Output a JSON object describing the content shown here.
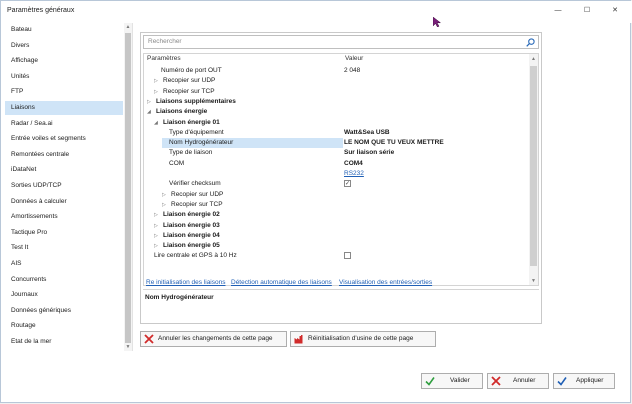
{
  "window": {
    "title": "Paramètres généraux",
    "minimize": "—",
    "maximize": "☐",
    "close": "✕"
  },
  "sidebar": {
    "items": [
      {
        "label": "Bateau"
      },
      {
        "label": "Divers"
      },
      {
        "label": "Affichage"
      },
      {
        "label": "Unités"
      },
      {
        "label": "FTP"
      },
      {
        "label": "Liaisons",
        "selected": true
      },
      {
        "label": "Radar / Sea.ai"
      },
      {
        "label": "Entrée voiles et segments"
      },
      {
        "label": "Remontées centrale"
      },
      {
        "label": "iDataNet"
      },
      {
        "label": "Sorties UDP/TCP"
      },
      {
        "label": "Données à calculer"
      },
      {
        "label": "Amortissements"
      },
      {
        "label": "Tactique Pro"
      },
      {
        "label": "Test It"
      },
      {
        "label": "AIS"
      },
      {
        "label": "Concurrents"
      },
      {
        "label": "Journaux"
      },
      {
        "label": "Données génériques"
      },
      {
        "label": "Routage"
      },
      {
        "label": "Etat de la mer"
      }
    ]
  },
  "search": {
    "placeholder": "Rechercher"
  },
  "grid": {
    "col_param": "Paramètres",
    "col_value": "Valeur",
    "rows": [
      {
        "label": "Numéro de port OUT",
        "value": "2 048",
        "indent": 1
      },
      {
        "label": "Recopier sur UDP",
        "indent": 1,
        "arrow": "▷"
      },
      {
        "label": "Recopier sur TCP",
        "indent": 1,
        "arrow": "▷"
      },
      {
        "label": "Liaisons supplémentaires",
        "indent": 0,
        "arrow": "▷",
        "bold": true
      },
      {
        "label": "Liaisons énergie",
        "indent": 0,
        "arrow": "◢",
        "bold": true
      },
      {
        "label": "Liaison énergie 01",
        "indent": 1,
        "arrow": "◢",
        "bold": true
      },
      {
        "label": "Type d'équipement",
        "value": "Watt&Sea USB",
        "indent": 2,
        "valbold": true
      },
      {
        "label": "Nom Hydrogénérateur",
        "value": "LE NOM QUE TU VEUX METTRE",
        "indent": 2,
        "valbold": true,
        "highlight": true
      },
      {
        "label": "Type de liaison",
        "value": "Sur liaison série",
        "indent": 2,
        "valbold": true
      },
      {
        "label": "COM",
        "value": "COM4",
        "indent": 2,
        "valbold": true
      },
      {
        "label": "",
        "value": "RS232",
        "indent": 2,
        "link": true
      },
      {
        "label": "Vérifier checksum",
        "indent": 2,
        "checkbox": true,
        "checked": true
      },
      {
        "label": "Recopier sur UDP",
        "indent": 2,
        "arrow": "▷"
      },
      {
        "label": "Recopier sur TCP",
        "indent": 2,
        "arrow": "▷"
      },
      {
        "label": "Liaison énergie 02",
        "indent": 1,
        "arrow": "▷",
        "bold": true
      },
      {
        "label": "Liaison énergie 03",
        "indent": 1,
        "arrow": "▷",
        "bold": true
      },
      {
        "label": "Liaison énergie 04",
        "indent": 1,
        "arrow": "▷",
        "bold": true
      },
      {
        "label": "Liaison énergie 05",
        "indent": 1,
        "arrow": "▷",
        "bold": true
      },
      {
        "label": "Lire centrale et GPS à 10 Hz",
        "indent": 0,
        "checkbox": true,
        "checked": false
      }
    ]
  },
  "links": {
    "reinit": "Re initialisation des liaisons",
    "detect": "Détection automatique des liaisons",
    "visu": "Visualisation des entrées/sorties"
  },
  "description": {
    "title": "Nom Hydrogénérateur"
  },
  "buttons": {
    "cancel_changes": "Annuler les changements de cette page",
    "factory_reset": "Réinitialisation d'usine de cette page",
    "validate": "Valider",
    "cancel": "Annuler",
    "apply": "Appliquer"
  },
  "colors": {
    "selection": "#cfe4f7",
    "link": "#1f5fb5",
    "check_green": "#2e9e3e",
    "cross_red": "#d12b2b"
  }
}
